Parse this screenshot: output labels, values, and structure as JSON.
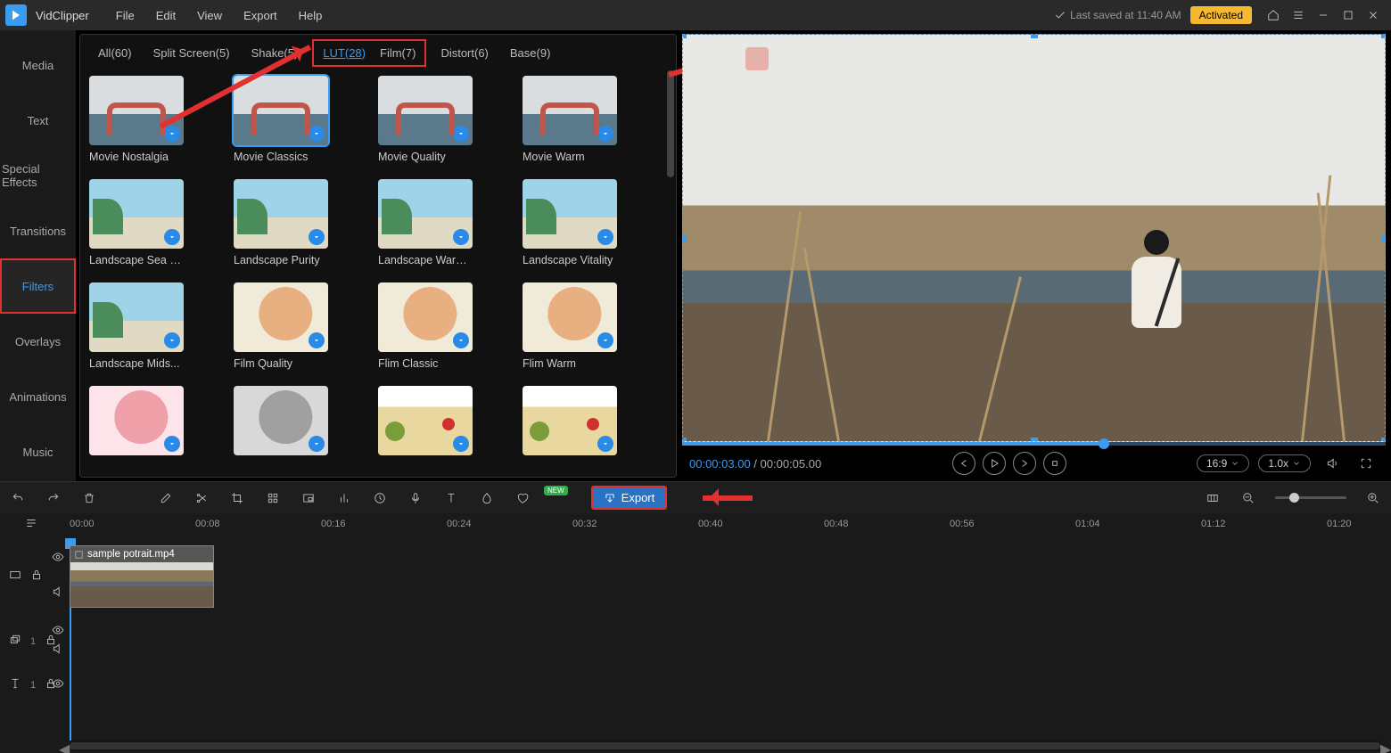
{
  "app": {
    "name": "VidClipper"
  },
  "menu": [
    "File",
    "Edit",
    "View",
    "Export",
    "Help"
  ],
  "status": {
    "saved": "Last saved at 11:40 AM",
    "activated": "Activated"
  },
  "side_nav": {
    "items": [
      "Media",
      "Text",
      "Special Effects",
      "Transitions",
      "Filters",
      "Overlays",
      "Animations",
      "Music"
    ],
    "active_index": 4
  },
  "filter_categories": [
    {
      "label": "All(60)"
    },
    {
      "label": "Split Screen(5)"
    },
    {
      "label": "Shake(5)"
    },
    {
      "label": "LUT(28)",
      "active": true
    },
    {
      "label": "Film(7)"
    },
    {
      "label": "Distort(6)"
    },
    {
      "label": "Base(9)"
    }
  ],
  "filters": [
    [
      {
        "name": "Movie Nostalgia",
        "thumb": "bridge"
      },
      {
        "name": "Movie Classics",
        "thumb": "bridge",
        "selected": true
      },
      {
        "name": "Movie Quality",
        "thumb": "bridge"
      },
      {
        "name": "Movie Warm",
        "thumb": "bridge"
      }
    ],
    [
      {
        "name": "Landscape Sea B...",
        "thumb": "beach"
      },
      {
        "name": "Landscape Purity",
        "thumb": "beach"
      },
      {
        "name": "Landscape Warm...",
        "thumb": "beach"
      },
      {
        "name": "Landscape Vitality",
        "thumb": "beach"
      }
    ],
    [
      {
        "name": "Landscape Mids...",
        "thumb": "beach"
      },
      {
        "name": "Film Quality",
        "thumb": "cat"
      },
      {
        "name": "Flim Classic",
        "thumb": "cat"
      },
      {
        "name": "Flim Warm",
        "thumb": "cat"
      }
    ],
    [
      {
        "name": "",
        "thumb": "cat-pk"
      },
      {
        "name": "",
        "thumb": "cat-gr"
      },
      {
        "name": "",
        "thumb": "food"
      },
      {
        "name": "",
        "thumb": "food"
      }
    ]
  ],
  "preview": {
    "current": "00:00:03.00",
    "total": "00:00:05.00",
    "ratio": "16:9",
    "speed": "1.0x"
  },
  "toolbar": {
    "new_badge": "NEW",
    "export": "Export"
  },
  "timeline": {
    "ticks": [
      "00:00",
      "00:08",
      "00:16",
      "00:24",
      "00:32",
      "00:40",
      "00:48",
      "00:56",
      "01:04",
      "01:12",
      "01:20"
    ],
    "clip_name": "sample potrait.mp4",
    "track2_lock": "1",
    "track3_lock": "1"
  }
}
